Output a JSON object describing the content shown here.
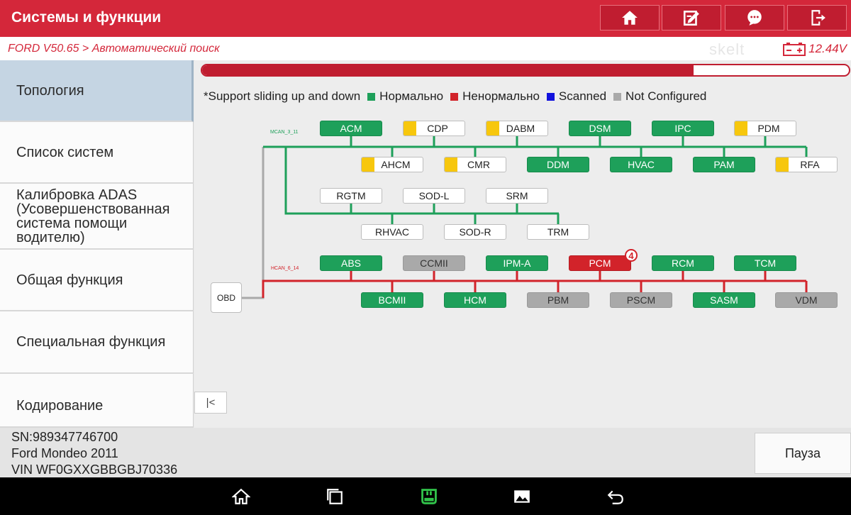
{
  "header": {
    "title": "Системы и функции",
    "buttons": [
      "home-icon",
      "edit-report-icon",
      "message-icon",
      "exit-icon"
    ]
  },
  "breadcrumb": "FORD V50.65 > Автоматический поиск",
  "watermark": "skelt",
  "voltage": "12.44V",
  "sidebar": {
    "items": [
      {
        "label": "Топология"
      },
      {
        "label": "Список систем"
      },
      {
        "label": "Калибровка ADAS (Усовершенствованная система помощи водителю)"
      },
      {
        "label": "Общая функция"
      },
      {
        "label": "Специальная функция"
      },
      {
        "label": "Кодирование"
      }
    ]
  },
  "progress": {
    "fraction": 0.76
  },
  "legend": {
    "hint": "*Support sliding up and down",
    "items": [
      {
        "label": "Нормально",
        "color": "#1ea05a"
      },
      {
        "label": "Ненормально",
        "color": "#d2232a"
      },
      {
        "label": "Scanned",
        "color": "#1111dd"
      },
      {
        "label": "Not Configured",
        "color": "#a9a9a9"
      }
    ]
  },
  "topology": {
    "bus_mcan": "MCAN_3_11",
    "bus_hcan": "HCAN_6_14",
    "obd": "OBD",
    "modules": {
      "acm": "ACM",
      "cdp": "CDP",
      "dabm": "DABM",
      "dsm": "DSM",
      "ipc": "IPC",
      "pdm": "PDM",
      "ahcm": "AHCM",
      "cmr": "CMR",
      "ddm": "DDM",
      "hvac": "HVAC",
      "pam": "PAM",
      "rfa": "RFA",
      "rgtm": "RGTM",
      "sodl": "SOD-L",
      "srm": "SRM",
      "rhvac": "RHVAC",
      "sodr": "SOD-R",
      "trm": "TRM",
      "abs": "ABS",
      "ccmii": "CCMII",
      "ipma": "IPM-A",
      "pcm": "PCM",
      "rcm": "RCM",
      "tcm": "TCM",
      "bcmii": "BCMII",
      "hcm": "HCM",
      "pbm": "PBM",
      "pscm": "PSCM",
      "sasm": "SASM",
      "vdm": "VDM"
    },
    "pcm_fault_count": "4"
  },
  "vehicle": {
    "sn": "SN:989347746700",
    "model": "Ford Mondeo 2011",
    "vin": "VIN WF0GXXGBBGBJ70336"
  },
  "pause_label": "Пауза",
  "colors": {
    "brand": "#d4273a",
    "normal": "#1ea05a",
    "abnormal": "#d2232a",
    "not_configured": "#a9a9a9",
    "unknown_tag": "#f7c70d"
  }
}
